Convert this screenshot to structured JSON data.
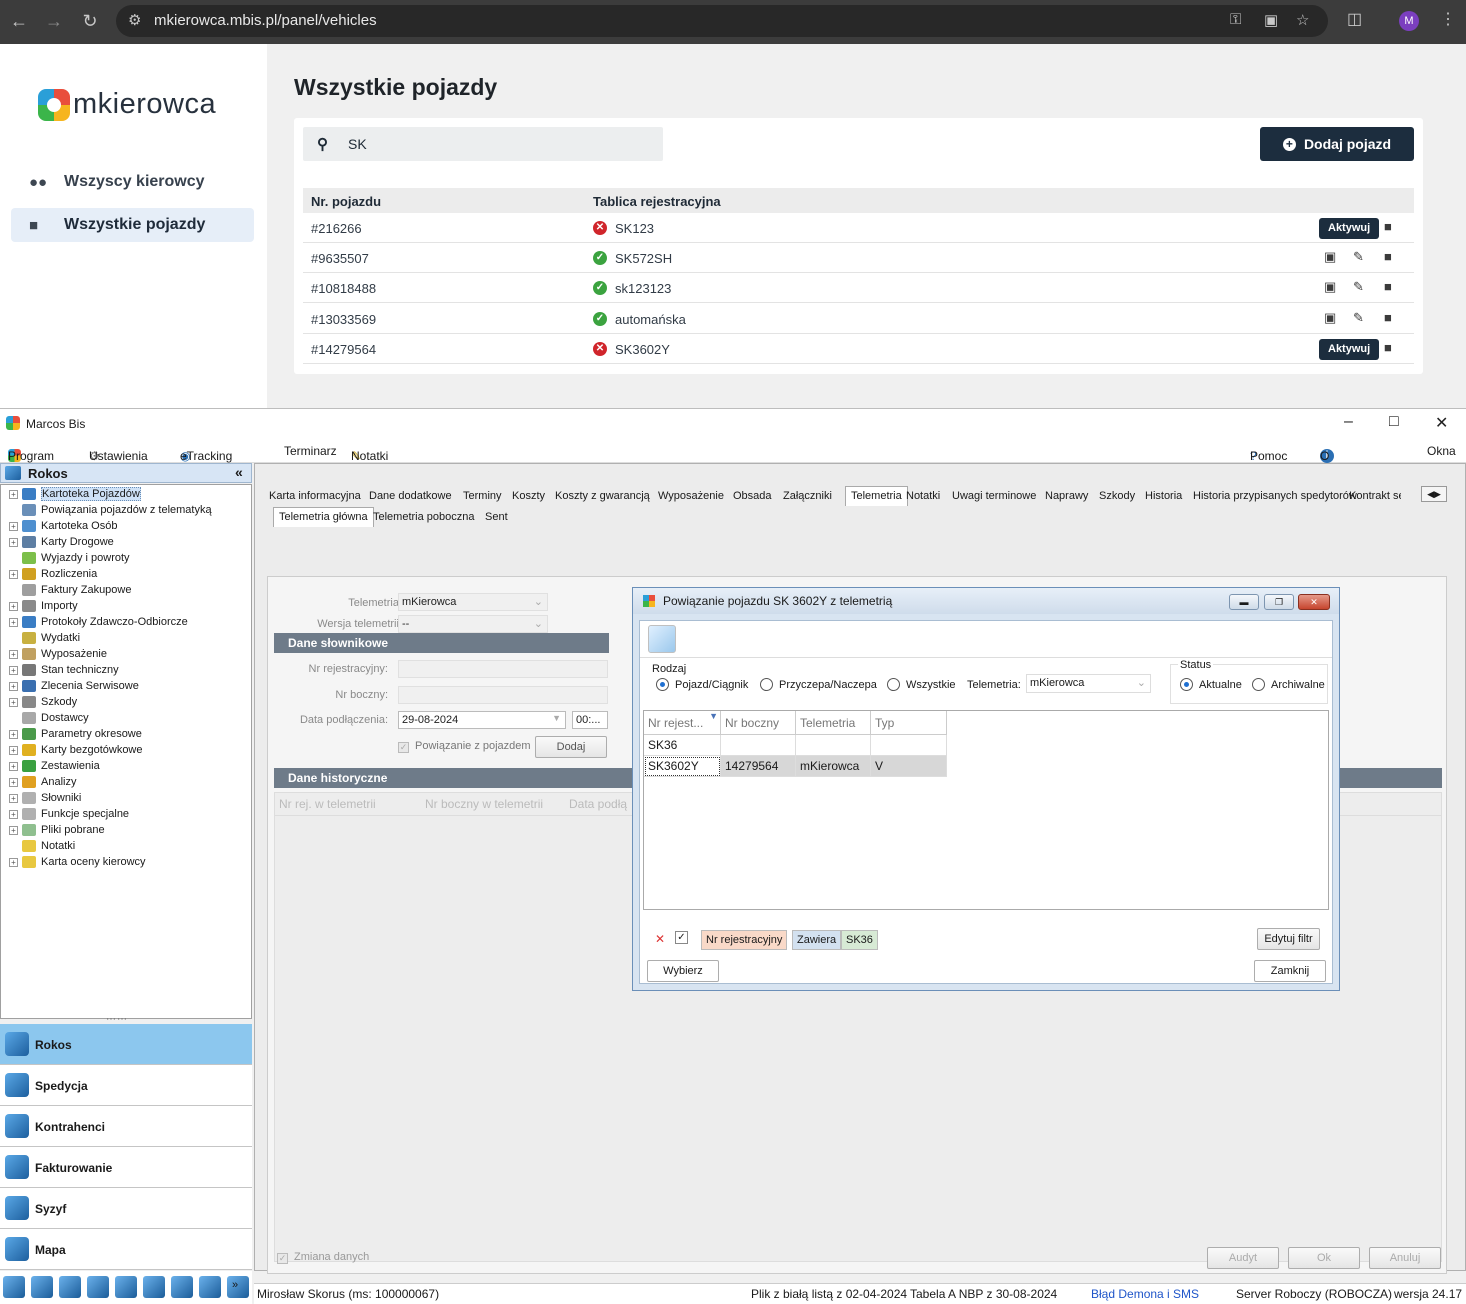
{
  "browser": {
    "url": "mkierowca.mbis.pl/panel/vehicles",
    "profile": "M"
  },
  "web": {
    "logo_text": "mkierowca",
    "nav": [
      {
        "label": "Wszyscy kierowcy",
        "icon": "users-icon"
      },
      {
        "label": "Wszystkie pojazdy",
        "icon": "truck-icon",
        "active": true
      }
    ],
    "title": "Wszystkie pojazdy",
    "search_value": "SK",
    "add_button": "Dodaj pojazd",
    "col_number": "Nr. pojazdu",
    "col_plate": "Tablica rejestracyjna",
    "rows": [
      {
        "number": "#216266",
        "plate": "SK123",
        "status": "error",
        "action": "Aktywuj"
      },
      {
        "number": "#9635507",
        "plate": "SK572SH",
        "status": "ok",
        "action": ""
      },
      {
        "number": "#10818488",
        "plate": "sk123123",
        "status": "ok",
        "action": ""
      },
      {
        "number": "#13033569",
        "plate": "automańska",
        "status": "ok",
        "action": ""
      },
      {
        "number": "#14279564",
        "plate": "SK3602Y",
        "status": "error",
        "action": "Aktywuj"
      }
    ]
  },
  "app": {
    "window_title": "Marcos Bis",
    "menu": {
      "program": "Program",
      "settings": "Ustawienia",
      "etracking": "eTracking",
      "terminarz": "Terminarz",
      "notatki": "Notatki",
      "help": "Pomoc",
      "about": "O programie",
      "windows": "Okna"
    },
    "left_header": "Rokos",
    "tree": [
      "Kartoteka Pojazdów",
      "Powiązania pojazdów z telematyką",
      "Kartoteka Osób",
      "Karty Drogowe",
      "Wyjazdy i powroty",
      "Rozliczenia",
      "Faktury Zakupowe",
      "Importy",
      "Protokoły Zdawczo-Odbiorcze",
      "Wydatki",
      "Wyposażenie",
      "Stan techniczny",
      "Zlecenia Serwisowe",
      "Szkody",
      "Dostawcy",
      "Parametry okresowe",
      "Karty bezgotówkowe",
      "Zestawienia",
      "Analizy",
      "Słowniki",
      "Funkcje specjalne",
      "Pliki pobrane",
      "Notatki",
      "Karta oceny kierowcy"
    ],
    "modules": [
      "Rokos",
      "Spedycja",
      "Kontrahenci",
      "Fakturowanie",
      "Syzyf",
      "Mapa"
    ],
    "tabs": [
      "Karta informacyjna",
      "Dane dodatkowe",
      "Terminy",
      "Koszty",
      "Koszty z gwarancją",
      "Wyposażenie",
      "Obsada",
      "Załączniki",
      "Telemetria",
      "Notatki",
      "Uwagi terminowe",
      "Naprawy",
      "Szkody",
      "Historia",
      "Historia przypisanych spedytorów",
      "Kontrakt ser"
    ],
    "subtabs": [
      "Telemetria główna",
      "Telemetria poboczna",
      "Sent"
    ],
    "form": {
      "telemetria_label": "Telemetria:",
      "telemetria_value": "mKierowca",
      "wersja_label": "Wersja telemetrii:",
      "wersja_value": "--",
      "section1": "Dane słownikowe",
      "nr_rej_label": "Nr rejestracyjny:",
      "nr_boczny_label": "Nr boczny:",
      "data_label": "Data podłączenia:",
      "data_value": "29-08-2024",
      "time_value": "00:...",
      "powiazanie": "Powiązanie z pojazdem",
      "dodaj": "Dodaj",
      "section2": "Dane historyczne",
      "hist_cols": [
        "Nr rej. w telemetrii",
        "Nr boczny w telemetrii",
        "Data podłą"
      ],
      "zmiana": "Zmiana danych",
      "audyt": "Audyt",
      "ok": "Ok",
      "anuluj": "Anuluj"
    },
    "status": {
      "user": "Mirosław Skorus (ms: 100000067)",
      "plik": "Plik z białą listą z 02-04-2024",
      "nbp": "Tabela A NBP z 30-08-2024",
      "blad": "Błąd Demona i SMS",
      "server": "Server Roboczy (ROBOCZA)",
      "version": "wersja 24.17"
    }
  },
  "dialog": {
    "title": "Powiązanie pojazdu SK 3602Y z telemetrią",
    "rodzaj_label": "Rodzaj",
    "rodzaj_options": [
      "Pojazd/Ciągnik",
      "Przyczepa/Naczepa",
      "Wszystkie"
    ],
    "telemetria_label": "Telemetria:",
    "telemetria_value": "mKierowca",
    "status_label": "Status",
    "status_options": [
      "Aktualne",
      "Archiwalne"
    ],
    "columns": [
      "Nr rejest...",
      "Nr boczny",
      "Telemetria",
      "Typ"
    ],
    "rows": [
      [
        "SK36",
        "",
        "",
        ""
      ],
      [
        "SK3602Y",
        "14279564",
        "mKierowca",
        "V"
      ]
    ],
    "filter": [
      "Nr rejestracyjny",
      "Zawiera",
      "SK36"
    ],
    "edit_filter": "Edytuj filtr",
    "select": "Wybierz",
    "close": "Zamknij"
  }
}
